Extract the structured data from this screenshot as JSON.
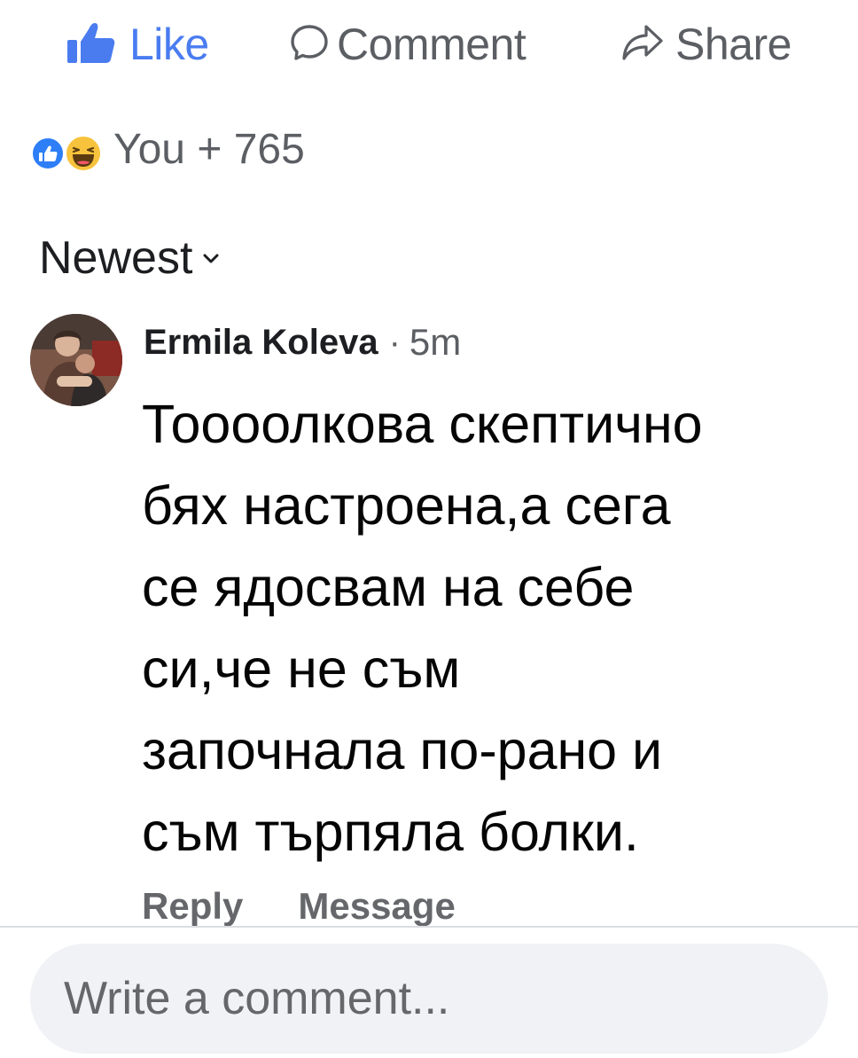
{
  "actions": {
    "like_label": "Like",
    "comment_label": "Comment",
    "share_label": "Share"
  },
  "reactions": {
    "summary": "You + 765",
    "icons": [
      "like-reaction-icon",
      "haha-reaction-icon"
    ]
  },
  "sort": {
    "label": "Newest"
  },
  "comment": {
    "author": "Ermila Koleva",
    "separator": "·",
    "time": "5m",
    "text": "Тоооолкова скептично\nбях настроена,а сега\nсе ядосвам на себе\nси,че не съм\nзапочнала по-рано и\nсъм търпяла болки.",
    "reply_label": "Reply",
    "message_label": "Message"
  },
  "composer": {
    "placeholder": "Write a comment..."
  },
  "colors": {
    "like_blue": "#4a7cf0",
    "muted_text": "#65676b",
    "composer_bg": "#f0f2f5"
  }
}
